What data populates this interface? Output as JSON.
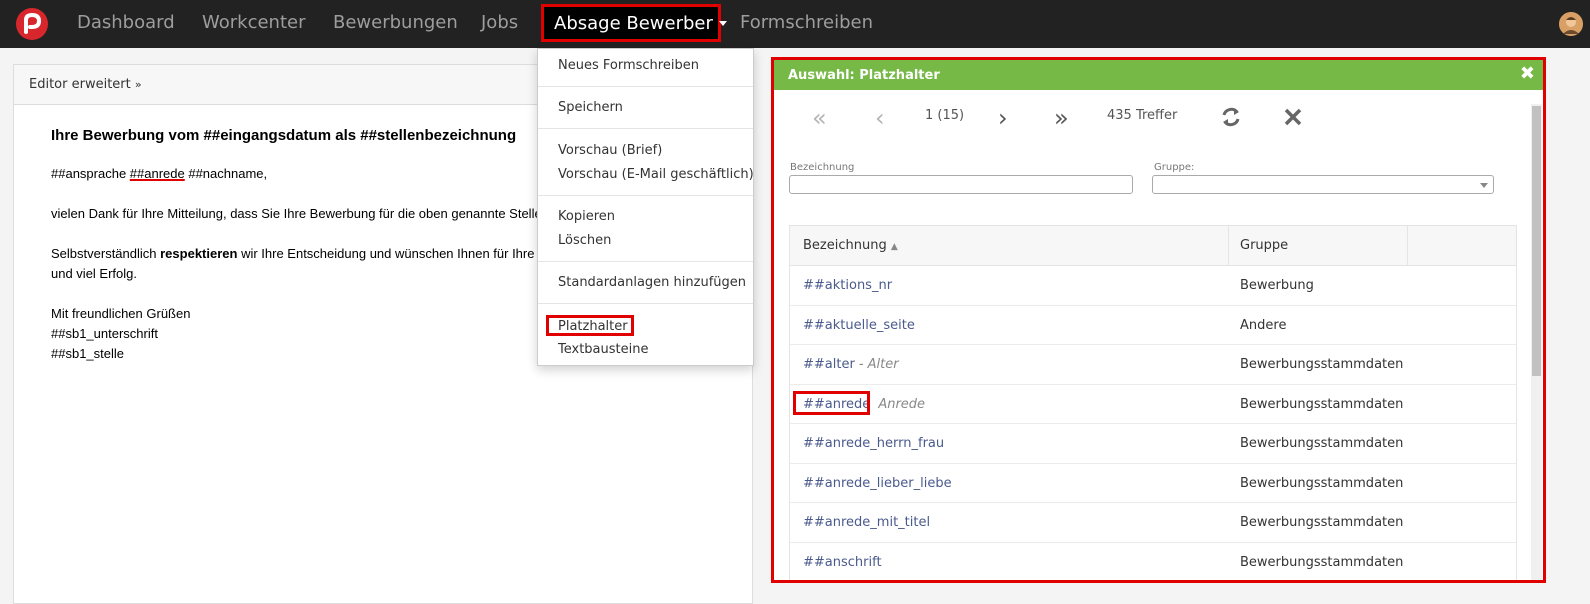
{
  "navbar": {
    "items": [
      "Dashboard",
      "Workcenter",
      "Bewerbungen",
      "Jobs"
    ],
    "active": "Absage Bewerber",
    "extra": "Formschreiben"
  },
  "editor": {
    "header_label": "Editor erweitert",
    "title": "Ihre Bewerbung vom ##eingangsdatum als ##stellenbezeichnung",
    "salutation_a": "##ansprache ",
    "salutation_b": "##anrede",
    "salutation_c": " ##nachname,",
    "para1": "vielen Dank für Ihre Mitteilung, dass Sie Ihre Bewerbung für die oben genannte Stelle",
    "para2_a": "Selbstverständlich ",
    "para2_b": "respektieren",
    "para2_c": " wir Ihre Entscheidung und wünschen Ihnen für Ihre b",
    "para2_d": "und viel Erfolg.",
    "closing": "Mit freundlichen Grüßen",
    "sig1": "##sb1_unterschrift",
    "sig2": "##sb1_stelle"
  },
  "dropdown": {
    "items": [
      "Neues Formschreiben",
      "Speichern",
      "Vorschau (Brief)",
      "Vorschau (E-Mail geschäftlich)",
      "Kopieren",
      "Löschen",
      "Standardanlagen hinzufügen",
      "Platzhalter",
      "Textbausteine"
    ]
  },
  "modal": {
    "title": "Auswahl: Platzhalter",
    "page_info": "1 (15)",
    "hits": "435 Treffer",
    "filter_label_name": "Bezeichnung",
    "filter_label_group": "Gruppe:",
    "col_name": "Bezeichnung",
    "col_group": "Gruppe",
    "rows": [
      {
        "name": "##aktions_nr",
        "desc": "",
        "group": "Bewerbung"
      },
      {
        "name": "##aktuelle_seite",
        "desc": "",
        "group": "Andere"
      },
      {
        "name": "##alter",
        "desc": "- Alter",
        "group": "Bewerbungsstammdaten"
      },
      {
        "name": "##anrede",
        "desc": "Anrede",
        "group": "Bewerbungsstammdaten"
      },
      {
        "name": "##anrede_herrn_frau",
        "desc": "",
        "group": "Bewerbungsstammdaten"
      },
      {
        "name": "##anrede_lieber_liebe",
        "desc": "",
        "group": "Bewerbungsstammdaten"
      },
      {
        "name": "##anrede_mit_titel",
        "desc": "",
        "group": "Bewerbungsstammdaten"
      },
      {
        "name": "##anschrift",
        "desc": "",
        "group": "Bewerbungsstammdaten"
      }
    ]
  },
  "colors": {
    "navbar_bg": "#222222",
    "highlight_red": "#e00000",
    "modal_header_green": "#76b947",
    "link_blue": "#4a5a8c"
  }
}
